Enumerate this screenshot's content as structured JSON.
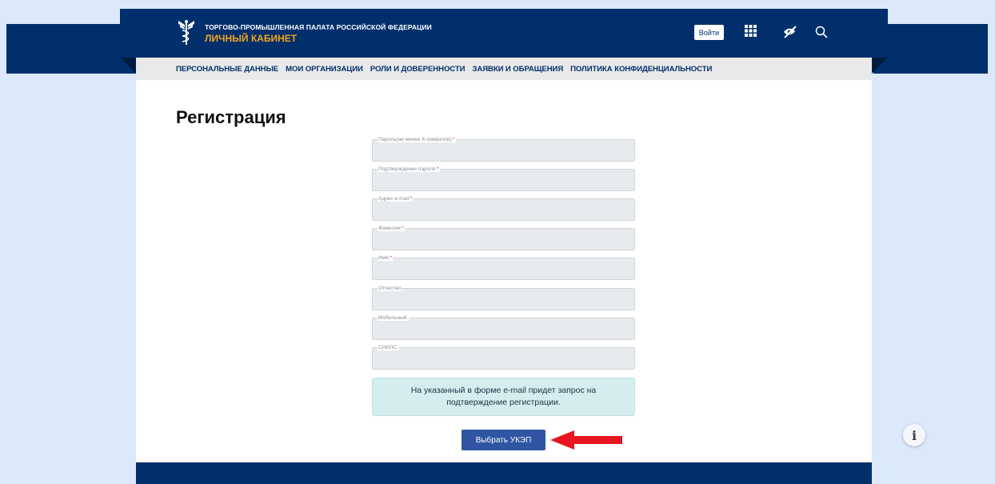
{
  "header": {
    "org_name": "ТОРГОВО-ПРОМЫШЛЕННАЯ ПАЛАТА РОССИЙСКОЙ ФЕДЕРАЦИИ",
    "cabinet_label": "ЛИЧНЫЙ КАБИНЕТ",
    "login_label": "Войти",
    "icons": [
      "apps-grid-icon",
      "visually-impaired-eye-icon",
      "search-icon"
    ],
    "colors": {
      "primary": "#012f6c",
      "accent": "#f3a51b"
    }
  },
  "nav": {
    "items": [
      {
        "label": "ПЕРСОНАЛЬНЫЕ ДАННЫЕ"
      },
      {
        "label": "МОИ ОРГАНИЗАЦИИ"
      },
      {
        "label": "РОЛИ И ДОВЕРЕННОСТИ"
      },
      {
        "label": "ЗАЯВКИ И ОБРАЩЕНИЯ"
      },
      {
        "label": "ПОЛИТИКА КОНФИДЕНЦИАЛЬНОСТИ"
      }
    ]
  },
  "main": {
    "title": "Регистрация",
    "fields": [
      {
        "label": "Пароль(не менее 6 символов):",
        "required": "*",
        "value": ""
      },
      {
        "label": "Подтверждение пароля:",
        "required": "*",
        "value": ""
      },
      {
        "label": "Адрес e-mail:",
        "required": "*",
        "value": ""
      },
      {
        "label": "Фамилия:",
        "required": "*",
        "value": ""
      },
      {
        "label": "Имя:",
        "required": "*",
        "value": ""
      },
      {
        "label": "Отчество",
        "required": "",
        "value": ""
      },
      {
        "label": "Мобильный:",
        "required": "",
        "value": ""
      },
      {
        "label": "СНИЛС:",
        "required": "",
        "value": ""
      }
    ],
    "notice": "На указанный в форме e-mail придет запрос на подтверждение регистрации.",
    "submit_label": "Выбрать УКЭП",
    "submit_color": "#2f55a3",
    "annotation_arrow_color": "#e5161f"
  },
  "info_button": {
    "icon": "info-icon",
    "glyph": "i"
  }
}
